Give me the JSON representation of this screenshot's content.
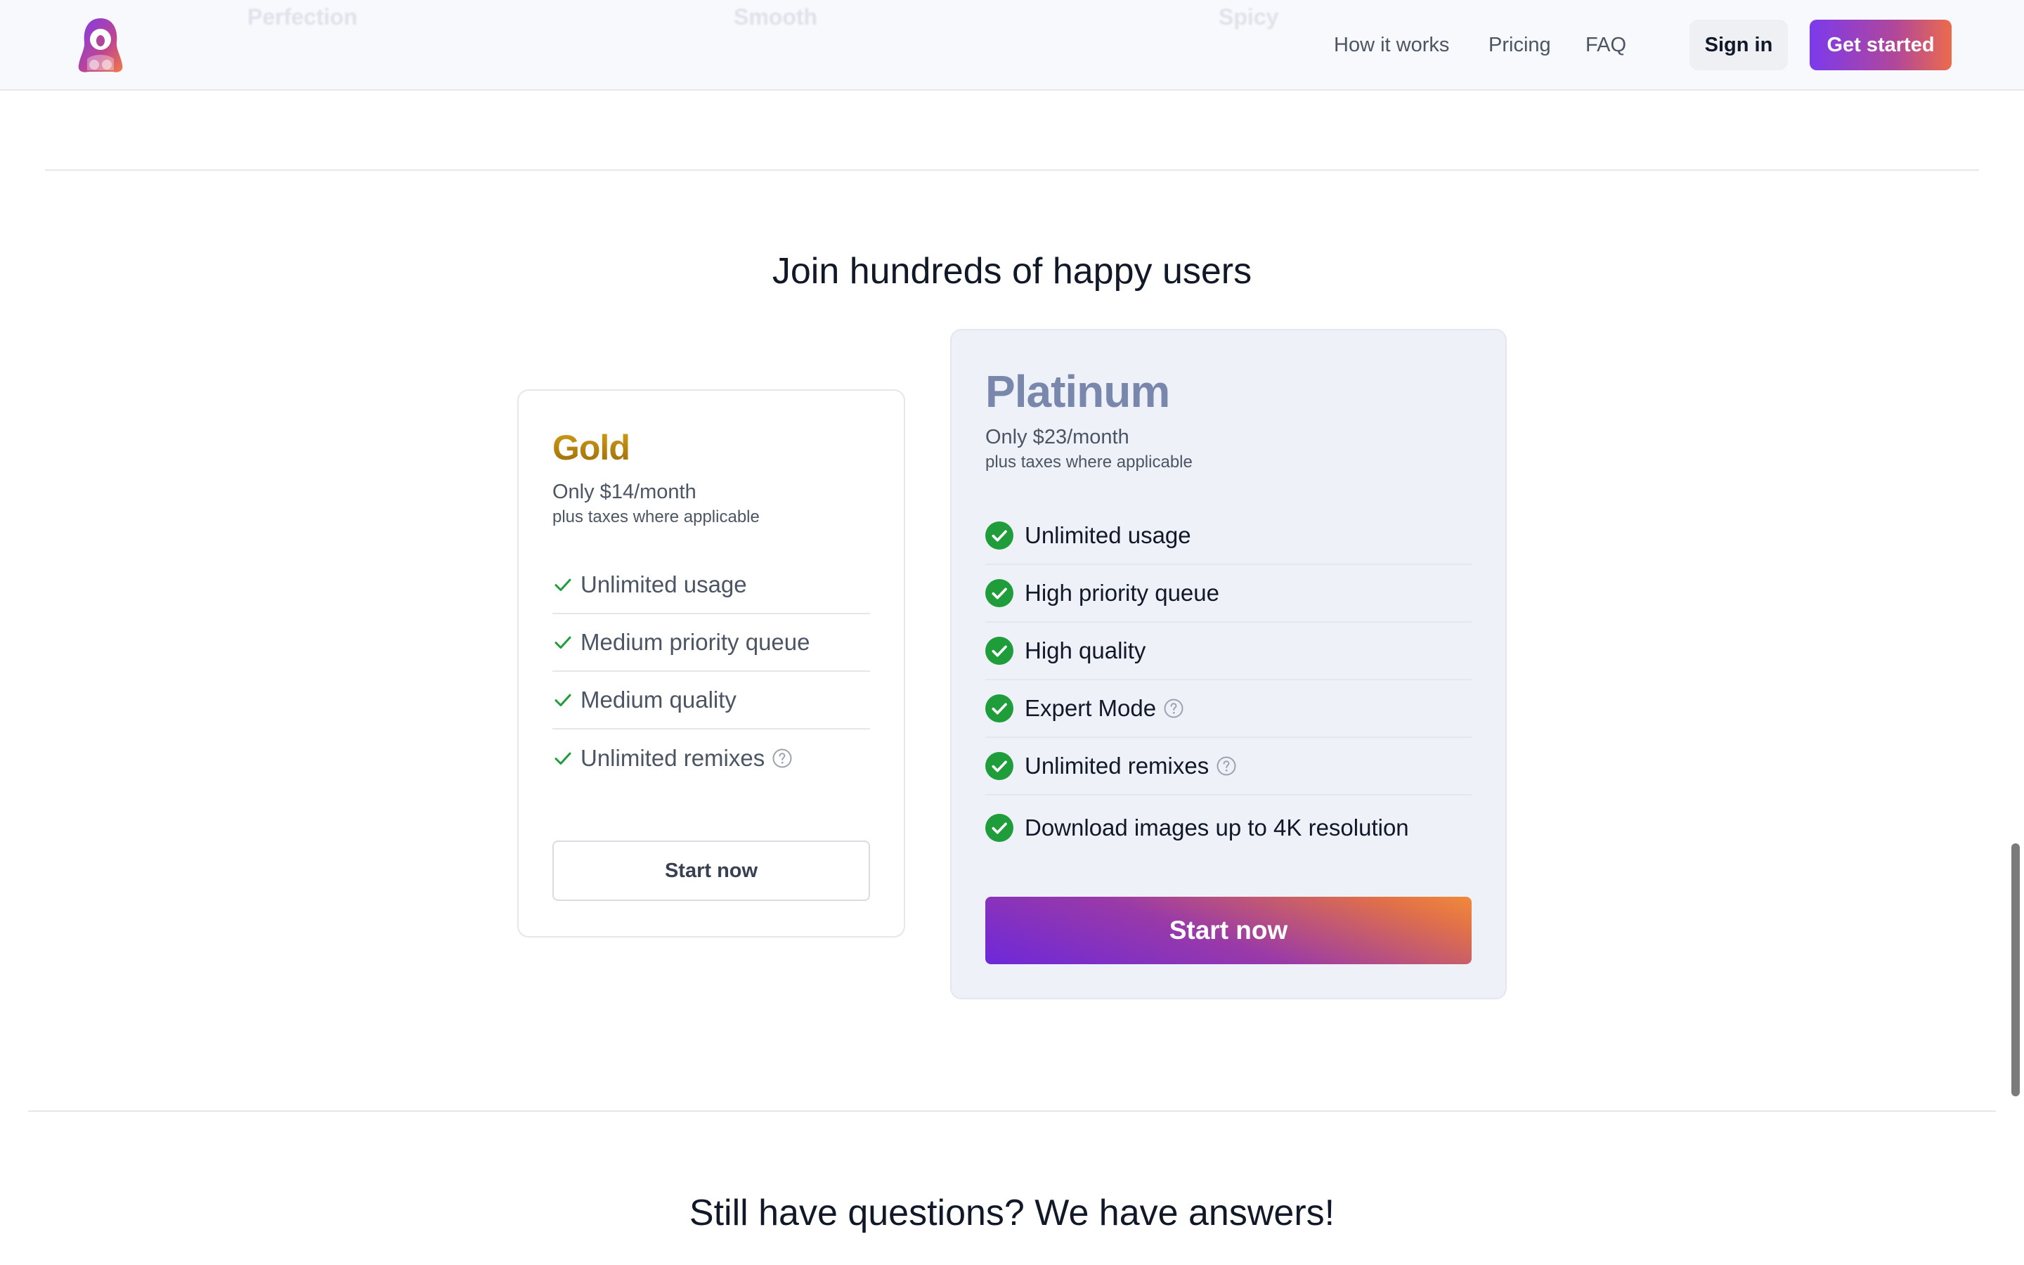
{
  "header": {
    "background_labels": [
      "Perfection",
      "Smooth",
      "Spicy"
    ],
    "nav": [
      {
        "label": "How it works"
      },
      {
        "label": "Pricing"
      },
      {
        "label": "FAQ"
      }
    ],
    "sign_in_label": "Sign in",
    "get_started_label": "Get started",
    "logo_icon": "astronaut-logo-icon"
  },
  "pricing": {
    "title": "Join hundreds of happy users",
    "plans": [
      {
        "name": "Gold",
        "price": "Only $14/month",
        "taxes": "plus taxes where applicable",
        "features": [
          "Unlimited usage",
          "Medium priority queue",
          "Medium quality",
          "Unlimited remixes"
        ],
        "cta": "Start now"
      },
      {
        "name": "Platinum",
        "price": "Only $23/month",
        "taxes": "plus taxes where applicable",
        "features": [
          "Unlimited usage",
          "High priority queue",
          "High quality",
          "Expert Mode",
          "Unlimited remixes",
          "Download images up to 4K resolution"
        ],
        "cta": "Start now"
      }
    ]
  },
  "faq": {
    "title": "Still have questions? We have answers!"
  },
  "colors": {
    "accent_purple": "#7c3aed",
    "accent_orange": "#f08a3a",
    "check_green": "#1f9d3a",
    "gold": "#c08a0e",
    "platinum": "#7a87ad"
  }
}
